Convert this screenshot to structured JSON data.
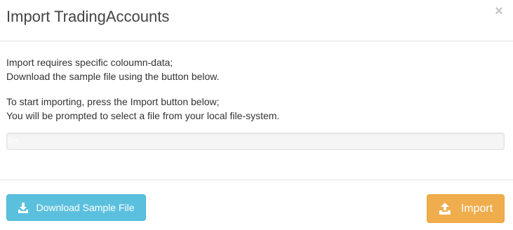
{
  "modal": {
    "title": "Import TradingAccounts",
    "close_label": "×"
  },
  "body": {
    "para1_line1": "Import requires specific coloumn-data;",
    "para1_line2": "Download the sample file using the button below.",
    "para2_line1": "To start importing, press the Import button below;",
    "para2_line2": "You will be prompted to select a file from your local file-system.",
    "progress": {
      "label": "0%",
      "value": 0
    }
  },
  "footer": {
    "download_label": "Download Sample File",
    "download_icon": "download-icon",
    "import_label": "Import",
    "import_icon": "upload-icon"
  },
  "colors": {
    "info": "#5bc0de",
    "warning": "#f0ad4e"
  }
}
